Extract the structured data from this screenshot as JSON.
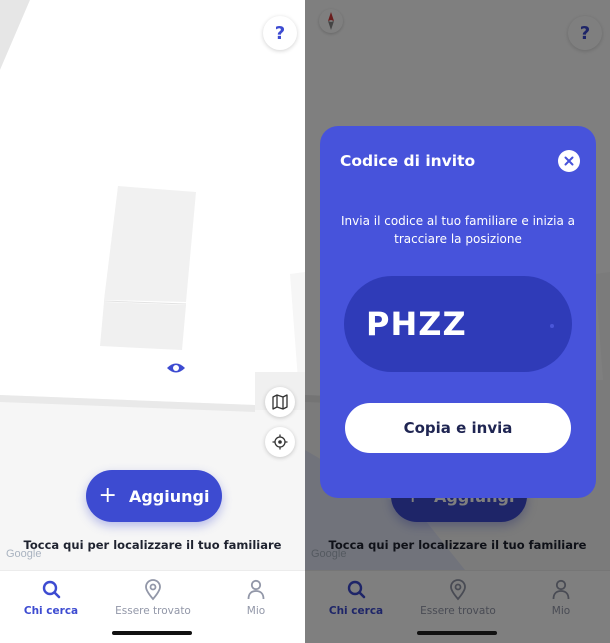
{
  "help_label": "?",
  "add_button": {
    "label": "Aggiungi",
    "icon": "plus-icon"
  },
  "hint": "Tocca qui per localizzare il tuo familiare",
  "google_label": "Google",
  "tabs": [
    {
      "label": "Chi cerca",
      "icon": "search-icon",
      "active": true
    },
    {
      "label": "Essere trovato",
      "icon": "location-pin-icon",
      "active": false
    },
    {
      "label": "Mio",
      "icon": "person-icon",
      "active": false
    }
  ],
  "modal": {
    "title": "Codice di invito",
    "description": "Invia il codice al tuo familiare e inizia a tracciare la posizione",
    "code": "PHZZ",
    "copy_button": "Copia e invia"
  },
  "colors": {
    "accent": "#3d4bd1",
    "modal_bg": "#4753db",
    "code_bg": "#2f3bb8",
    "inactive_tab": "#9297a8"
  }
}
